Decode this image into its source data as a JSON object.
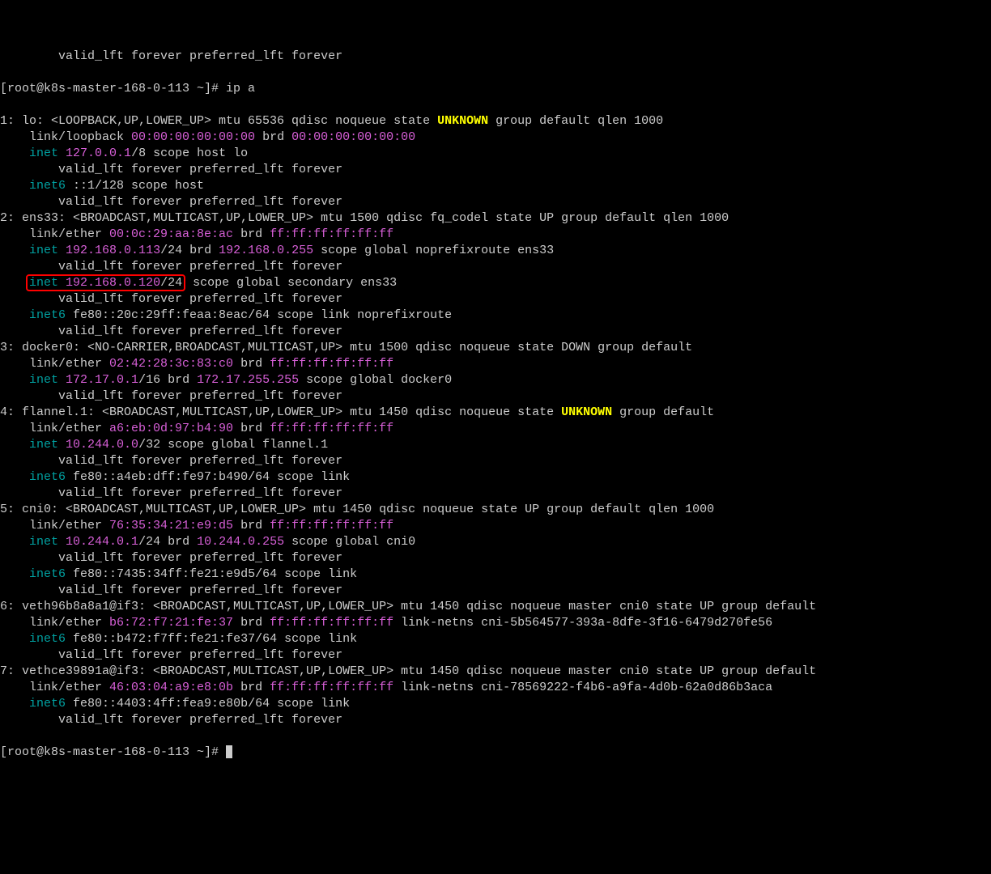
{
  "top_truncated": "        valid_lft forever preferred_lft forever",
  "prompt1": {
    "prefix": "[root@k8s-master-168-0-113 ~]# ",
    "cmd": "ip a"
  },
  "prompt2": {
    "prefix": "[root@k8s-master-168-0-113 ~]# "
  },
  "interfaces": [
    {
      "idx": "1",
      "name": "lo",
      "flags": "<LOOPBACK,UP,LOWER_UP>",
      "rest": " mtu 65536 qdisc noqueue state ",
      "state": "UNKNOWN",
      "state_color": "yellow",
      "tail": " group default qlen 1000",
      "link": {
        "type": "link/loopback",
        "mac": "00:00:00:00:00:00",
        "brd_label": " brd ",
        "brd": "00:00:00:00:00:00",
        "extra": ""
      },
      "addrs": [
        {
          "proto": "inet",
          "ip": "127.0.0.1",
          "mask": "/8",
          "rest": " scope host lo",
          "valid": "valid_lft forever preferred_lft forever",
          "highlight": false
        },
        {
          "proto": "inet6",
          "ip": "::1/128",
          "mask": "",
          "rest": " scope host",
          "valid": "valid_lft forever preferred_lft forever",
          "highlight": false,
          "nocolor": true
        }
      ]
    },
    {
      "idx": "2",
      "name": "ens33",
      "flags": "<BROADCAST,MULTICAST,UP,LOWER_UP>",
      "rest": " mtu 1500 qdisc fq_codel state UP group default qlen 1000",
      "state": "",
      "state_color": "",
      "tail": "",
      "link": {
        "type": "link/ether",
        "mac": "00:0c:29:aa:8e:ac",
        "brd_label": " brd ",
        "brd": "ff:ff:ff:ff:ff:ff",
        "extra": ""
      },
      "addrs": [
        {
          "proto": "inet",
          "ip": "192.168.0.113",
          "mask": "/24",
          "brd_label": " brd ",
          "brd": "192.168.0.255",
          "rest": " scope global noprefixroute ens33",
          "valid": "valid_lft forever preferred_lft forever",
          "highlight": false
        },
        {
          "proto": "inet",
          "ip": "192.168.0.120",
          "mask": "/24",
          "rest": " scope global secondary ens33",
          "valid": "valid_lft forever preferred_lft forever",
          "highlight": true
        },
        {
          "proto": "inet6",
          "ip": "fe80::20c:29ff:feaa:8eac/64",
          "mask": "",
          "rest": " scope link noprefixroute",
          "valid": "valid_lft forever preferred_lft forever",
          "highlight": false,
          "nocolor": true
        }
      ]
    },
    {
      "idx": "3",
      "name": "docker0",
      "flags": "<NO-CARRIER,BROADCAST,MULTICAST,UP>",
      "rest": " mtu 1500 qdisc noqueue state DOWN group default",
      "state": "",
      "state_color": "",
      "tail": "",
      "link": {
        "type": "link/ether",
        "mac": "02:42:28:3c:83:c0",
        "brd_label": " brd ",
        "brd": "ff:ff:ff:ff:ff:ff",
        "extra": ""
      },
      "addrs": [
        {
          "proto": "inet",
          "ip": "172.17.0.1",
          "mask": "/16",
          "brd_label": " brd ",
          "brd": "172.17.255.255",
          "rest": " scope global docker0",
          "valid": "valid_lft forever preferred_lft forever",
          "highlight": false
        }
      ]
    },
    {
      "idx": "4",
      "name": "flannel.1",
      "flags": "<BROADCAST,MULTICAST,UP,LOWER_UP>",
      "rest": " mtu 1450 qdisc noqueue state ",
      "state": "UNKNOWN",
      "state_color": "yellow",
      "tail": " group default",
      "link": {
        "type": "link/ether",
        "mac": "a6:eb:0d:97:b4:90",
        "brd_label": " brd ",
        "brd": "ff:ff:ff:ff:ff:ff",
        "extra": ""
      },
      "addrs": [
        {
          "proto": "inet",
          "ip": "10.244.0.0",
          "mask": "/32",
          "rest": " scope global flannel.1",
          "valid": "valid_lft forever preferred_lft forever",
          "highlight": false
        },
        {
          "proto": "inet6",
          "ip": "fe80::a4eb:dff:fe97:b490/64",
          "mask": "",
          "rest": " scope link",
          "valid": "valid_lft forever preferred_lft forever",
          "highlight": false,
          "nocolor": true
        }
      ]
    },
    {
      "idx": "5",
      "name": "cni0",
      "flags": "<BROADCAST,MULTICAST,UP,LOWER_UP>",
      "rest": " mtu 1450 qdisc noqueue state UP group default qlen 1000",
      "state": "",
      "state_color": "",
      "tail": "",
      "link": {
        "type": "link/ether",
        "mac": "76:35:34:21:e9:d5",
        "brd_label": " brd ",
        "brd": "ff:ff:ff:ff:ff:ff",
        "extra": ""
      },
      "addrs": [
        {
          "proto": "inet",
          "ip": "10.244.0.1",
          "mask": "/24",
          "brd_label": " brd ",
          "brd": "10.244.0.255",
          "rest": " scope global cni0",
          "valid": "valid_lft forever preferred_lft forever",
          "highlight": false
        },
        {
          "proto": "inet6",
          "ip": "fe80::7435:34ff:fe21:e9d5/64",
          "mask": "",
          "rest": " scope link",
          "valid": "valid_lft forever preferred_lft forever",
          "highlight": false,
          "nocolor": true
        }
      ]
    },
    {
      "idx": "6",
      "name": "veth96b8a8a1@if3",
      "flags": "<BROADCAST,MULTICAST,UP,LOWER_UP>",
      "rest": " mtu 1450 qdisc noqueue master cni0 state UP group default",
      "state": "",
      "state_color": "",
      "tail": "",
      "link": {
        "type": "link/ether",
        "mac": "b6:72:f7:21:fe:37",
        "brd_label": " brd ",
        "brd": "ff:ff:ff:ff:ff:ff",
        "extra": " link-netns cni-5b564577-393a-8dfe-3f16-6479d270fe56"
      },
      "addrs": [
        {
          "proto": "inet6",
          "ip": "fe80::b472:f7ff:fe21:fe37/64",
          "mask": "",
          "rest": " scope link",
          "valid": "valid_lft forever preferred_lft forever",
          "highlight": false,
          "nocolor": true
        }
      ]
    },
    {
      "idx": "7",
      "name": "vethce39891a@if3",
      "flags": "<BROADCAST,MULTICAST,UP,LOWER_UP>",
      "rest": " mtu 1450 qdisc noqueue master cni0 state UP group default",
      "state": "",
      "state_color": "",
      "tail": "",
      "link": {
        "type": "link/ether",
        "mac": "46:03:04:a9:e8:0b",
        "brd_label": " brd ",
        "brd": "ff:ff:ff:ff:ff:ff",
        "extra": " link-netns cni-78569222-f4b6-a9fa-4d0b-62a0d86b3aca"
      },
      "addrs": [
        {
          "proto": "inet6",
          "ip": "fe80::4403:4ff:fea9:e80b/64",
          "mask": "",
          "rest": " scope link",
          "valid": "valid_lft forever preferred_lft forever",
          "highlight": false,
          "nocolor": true
        }
      ]
    }
  ]
}
